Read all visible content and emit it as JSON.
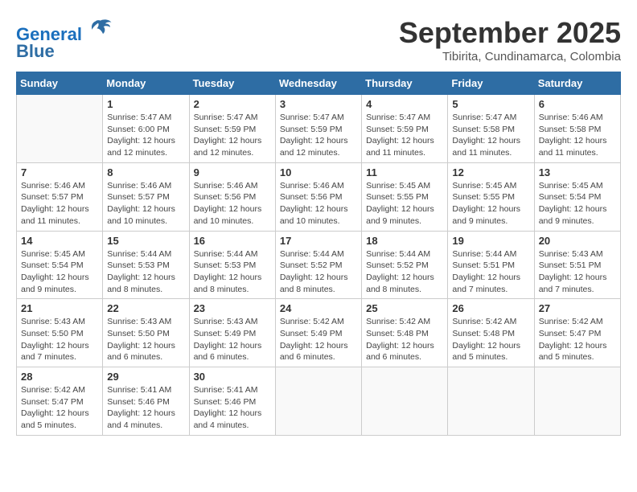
{
  "header": {
    "logo_line1": "General",
    "logo_line2": "Blue",
    "month_title": "September 2025",
    "subtitle": "Tibirita, Cundinamarca, Colombia"
  },
  "weekdays": [
    "Sunday",
    "Monday",
    "Tuesday",
    "Wednesday",
    "Thursday",
    "Friday",
    "Saturday"
  ],
  "weeks": [
    [
      {
        "day": "",
        "info": ""
      },
      {
        "day": "1",
        "info": "Sunrise: 5:47 AM\nSunset: 6:00 PM\nDaylight: 12 hours\nand 12 minutes."
      },
      {
        "day": "2",
        "info": "Sunrise: 5:47 AM\nSunset: 5:59 PM\nDaylight: 12 hours\nand 12 minutes."
      },
      {
        "day": "3",
        "info": "Sunrise: 5:47 AM\nSunset: 5:59 PM\nDaylight: 12 hours\nand 12 minutes."
      },
      {
        "day": "4",
        "info": "Sunrise: 5:47 AM\nSunset: 5:59 PM\nDaylight: 12 hours\nand 11 minutes."
      },
      {
        "day": "5",
        "info": "Sunrise: 5:47 AM\nSunset: 5:58 PM\nDaylight: 12 hours\nand 11 minutes."
      },
      {
        "day": "6",
        "info": "Sunrise: 5:46 AM\nSunset: 5:58 PM\nDaylight: 12 hours\nand 11 minutes."
      }
    ],
    [
      {
        "day": "7",
        "info": "Sunrise: 5:46 AM\nSunset: 5:57 PM\nDaylight: 12 hours\nand 11 minutes."
      },
      {
        "day": "8",
        "info": "Sunrise: 5:46 AM\nSunset: 5:57 PM\nDaylight: 12 hours\nand 10 minutes."
      },
      {
        "day": "9",
        "info": "Sunrise: 5:46 AM\nSunset: 5:56 PM\nDaylight: 12 hours\nand 10 minutes."
      },
      {
        "day": "10",
        "info": "Sunrise: 5:46 AM\nSunset: 5:56 PM\nDaylight: 12 hours\nand 10 minutes."
      },
      {
        "day": "11",
        "info": "Sunrise: 5:45 AM\nSunset: 5:55 PM\nDaylight: 12 hours\nand 9 minutes."
      },
      {
        "day": "12",
        "info": "Sunrise: 5:45 AM\nSunset: 5:55 PM\nDaylight: 12 hours\nand 9 minutes."
      },
      {
        "day": "13",
        "info": "Sunrise: 5:45 AM\nSunset: 5:54 PM\nDaylight: 12 hours\nand 9 minutes."
      }
    ],
    [
      {
        "day": "14",
        "info": "Sunrise: 5:45 AM\nSunset: 5:54 PM\nDaylight: 12 hours\nand 9 minutes."
      },
      {
        "day": "15",
        "info": "Sunrise: 5:44 AM\nSunset: 5:53 PM\nDaylight: 12 hours\nand 8 minutes."
      },
      {
        "day": "16",
        "info": "Sunrise: 5:44 AM\nSunset: 5:53 PM\nDaylight: 12 hours\nand 8 minutes."
      },
      {
        "day": "17",
        "info": "Sunrise: 5:44 AM\nSunset: 5:52 PM\nDaylight: 12 hours\nand 8 minutes."
      },
      {
        "day": "18",
        "info": "Sunrise: 5:44 AM\nSunset: 5:52 PM\nDaylight: 12 hours\nand 8 minutes."
      },
      {
        "day": "19",
        "info": "Sunrise: 5:44 AM\nSunset: 5:51 PM\nDaylight: 12 hours\nand 7 minutes."
      },
      {
        "day": "20",
        "info": "Sunrise: 5:43 AM\nSunset: 5:51 PM\nDaylight: 12 hours\nand 7 minutes."
      }
    ],
    [
      {
        "day": "21",
        "info": "Sunrise: 5:43 AM\nSunset: 5:50 PM\nDaylight: 12 hours\nand 7 minutes."
      },
      {
        "day": "22",
        "info": "Sunrise: 5:43 AM\nSunset: 5:50 PM\nDaylight: 12 hours\nand 6 minutes."
      },
      {
        "day": "23",
        "info": "Sunrise: 5:43 AM\nSunset: 5:49 PM\nDaylight: 12 hours\nand 6 minutes."
      },
      {
        "day": "24",
        "info": "Sunrise: 5:42 AM\nSunset: 5:49 PM\nDaylight: 12 hours\nand 6 minutes."
      },
      {
        "day": "25",
        "info": "Sunrise: 5:42 AM\nSunset: 5:48 PM\nDaylight: 12 hours\nand 6 minutes."
      },
      {
        "day": "26",
        "info": "Sunrise: 5:42 AM\nSunset: 5:48 PM\nDaylight: 12 hours\nand 5 minutes."
      },
      {
        "day": "27",
        "info": "Sunrise: 5:42 AM\nSunset: 5:47 PM\nDaylight: 12 hours\nand 5 minutes."
      }
    ],
    [
      {
        "day": "28",
        "info": "Sunrise: 5:42 AM\nSunset: 5:47 PM\nDaylight: 12 hours\nand 5 minutes."
      },
      {
        "day": "29",
        "info": "Sunrise: 5:41 AM\nSunset: 5:46 PM\nDaylight: 12 hours\nand 4 minutes."
      },
      {
        "day": "30",
        "info": "Sunrise: 5:41 AM\nSunset: 5:46 PM\nDaylight: 12 hours\nand 4 minutes."
      },
      {
        "day": "",
        "info": ""
      },
      {
        "day": "",
        "info": ""
      },
      {
        "day": "",
        "info": ""
      },
      {
        "day": "",
        "info": ""
      }
    ]
  ]
}
